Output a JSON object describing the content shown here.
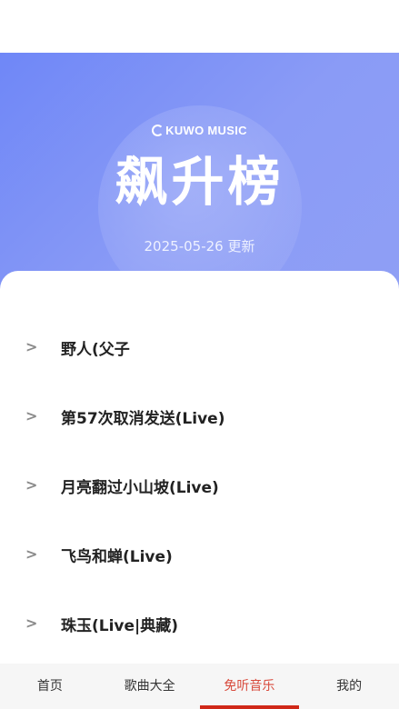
{
  "hero": {
    "brand": "KUWO MUSIC",
    "title": "飙升榜",
    "update_date": "2025-05-26 更新"
  },
  "songs": [
    {
      "arrow": ">",
      "title": "野人(父子"
    },
    {
      "arrow": ">",
      "title": "第57次取消发送(Live)"
    },
    {
      "arrow": ">",
      "title": "月亮翻过小山坡(Live)"
    },
    {
      "arrow": ">",
      "title": "飞鸟和蝉(Live)"
    },
    {
      "arrow": ">",
      "title": "珠玉(Live|典藏)"
    }
  ],
  "nav": {
    "tabs": [
      {
        "label": "首页",
        "active": false
      },
      {
        "label": "歌曲大全",
        "active": false
      },
      {
        "label": "免听音乐",
        "active": true
      },
      {
        "label": "我的",
        "active": false
      }
    ]
  },
  "colors": {
    "hero_gradient_start": "#6f87f7",
    "hero_gradient_end": "#8f9ff5",
    "active_tab": "#d84a3c",
    "active_indicator": "#d02818"
  }
}
